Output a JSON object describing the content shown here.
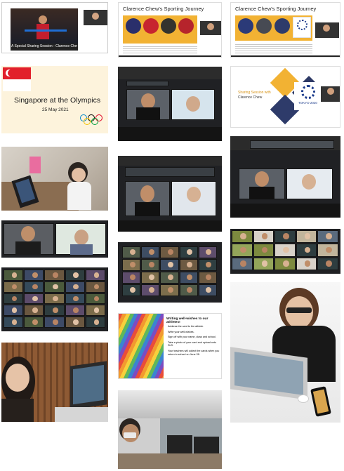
{
  "tiles": {
    "special_sharing": {
      "caption": "A Special Sharing Session - Clarence Chew"
    },
    "journey_a": {
      "title": "Clarence Chew's Sporting Journey"
    },
    "journey_b": {
      "title": "Clarence Chew's Sporting Journey"
    },
    "olympics_title": {
      "title": "Singapore at the Olympics",
      "date": "25 May 2021"
    },
    "sharing_slide": {
      "line1": "Sharing Session with",
      "line2": "Clarence Chew",
      "logo_text": "TOKYO 2020"
    },
    "well_wishes": {
      "title": "Writing well-wishes to our athletes!",
      "items": [
        "Address the card to the athlete.",
        "Write your well-wishes.",
        "Sign off with your name, class and school.",
        "Take a photo of your card and upload onto SLS.",
        "Your teachers will collect the cards when you return to school on June 28."
      ]
    }
  },
  "colors": {
    "gold": "#f2b233",
    "slide_cream": "#fdf3dc",
    "singapore_red": "#e2202b",
    "olympic_blue": "#0085c7",
    "olympic_yellow": "#f4c300",
    "olympic_black": "#000000",
    "olympic_green": "#009f3d",
    "olympic_red": "#df0024"
  }
}
